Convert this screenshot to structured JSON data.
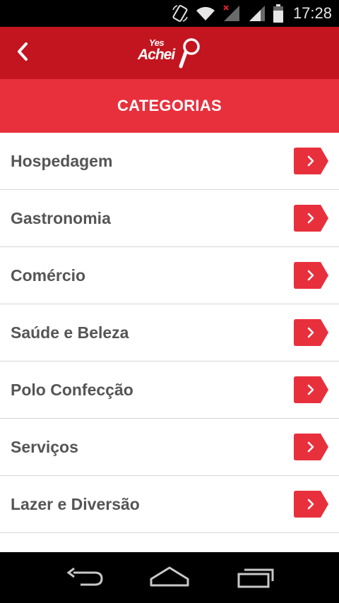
{
  "status_bar": {
    "time": "17:28",
    "icons": [
      "rotate-icon",
      "wifi-icon",
      "signal-no-sim-icon",
      "signal-icon",
      "battery-icon"
    ]
  },
  "app_bar": {
    "logo_line1": "Yes",
    "logo_line2": "Achei"
  },
  "header": {
    "title": "CATEGORIAS"
  },
  "categories": [
    {
      "label": "Hospedagem"
    },
    {
      "label": "Gastronomia"
    },
    {
      "label": "Comércio"
    },
    {
      "label": "Saúde e Beleza"
    },
    {
      "label": "Polo Confecção"
    },
    {
      "label": "Serviços"
    },
    {
      "label": "Lazer e Diversão"
    },
    {
      "label": ""
    }
  ],
  "colors": {
    "app_bar": "#c3151f",
    "header": "#e8303d",
    "arrow_button": "#e8303d",
    "label_text": "#555555",
    "divider": "#d6d6d6"
  }
}
